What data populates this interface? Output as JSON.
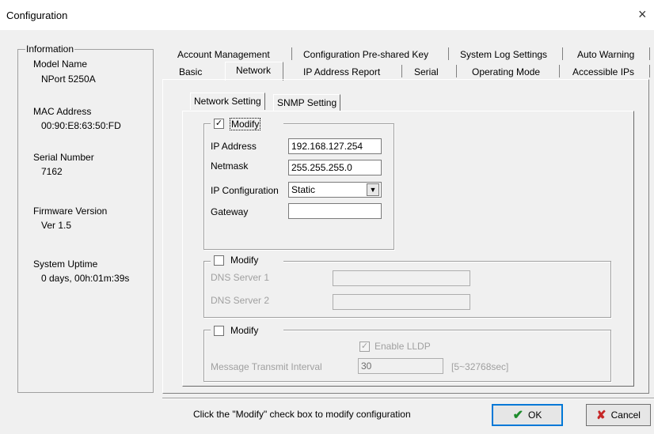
{
  "window": {
    "title": "Configuration",
    "close_glyph": "×"
  },
  "info": {
    "legend": "Information",
    "model_label": "Model Name",
    "model_value": "NPort 5250A",
    "mac_label": "MAC Address",
    "mac_value": "00:90:E8:63:50:FD",
    "serial_label": "Serial Number",
    "serial_value": "7162",
    "fw_label": "Firmware Version",
    "fw_value": "Ver 1.5",
    "uptime_label": "System Uptime",
    "uptime_value": "0 days, 00h:01m:39s"
  },
  "tabs_row1": [
    "Account Management",
    "Configuration Pre-shared Key",
    "System Log Settings",
    "Auto Warning"
  ],
  "tabs_row2": [
    "Basic",
    "Network",
    "IP Address Report",
    "Serial",
    "Operating Mode",
    "Accessible IPs"
  ],
  "active_tab": "Network",
  "subtabs": [
    "Network Setting",
    "SNMP Setting"
  ],
  "network": {
    "modify_label": "Modify",
    "modify_checked": "✓",
    "ip_label": "IP Address",
    "ip_value": "192.168.127.254",
    "netmask_label": "Netmask",
    "netmask_value": "255.255.255.0",
    "ipconf_label": "IP Configuration",
    "ipconf_value": "Static",
    "gateway_label": "Gateway",
    "gateway_value": ""
  },
  "dns": {
    "modify_label": "Modify",
    "dns1_label": "DNS Server 1",
    "dns1_value": "",
    "dns2_label": "DNS Server 2",
    "dns2_value": ""
  },
  "lldp": {
    "modify_label": "Modify",
    "enable_label": "Enable LLDP",
    "enable_checked": "✓",
    "interval_label": "Message Transmit Interval",
    "interval_value": "30",
    "interval_range": "[5~32768sec]"
  },
  "footer": {
    "hint": "Click the \"Modify\" check box to modify configuration",
    "ok_label": "OK",
    "ok_icon": "check-icon",
    "ok_glyph": "✔",
    "cancel_label": "Cancel",
    "cancel_icon": "cross-icon",
    "cancel_glyph": "✘"
  },
  "colors": {
    "ok_green": "#1e8c2c",
    "cancel_red": "#c62828"
  }
}
